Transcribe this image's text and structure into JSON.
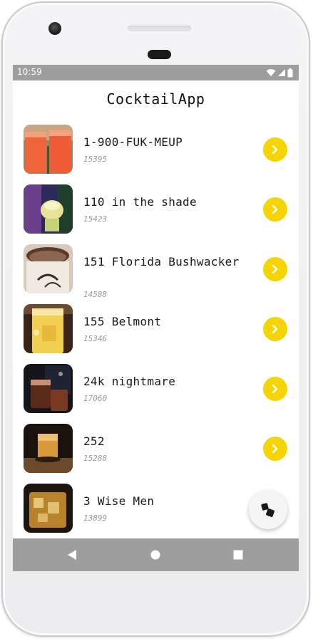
{
  "status_bar": {
    "time": "10:59",
    "icons": [
      "wifi-icon",
      "signal-icon",
      "battery-icon"
    ]
  },
  "app": {
    "title": "CocktailApp"
  },
  "drinks": [
    {
      "name": "1-900-FUK-MEUP",
      "id": "15395"
    },
    {
      "name": "110 in the shade",
      "id": "15423"
    },
    {
      "name": "151 Florida Bushwacker",
      "id": "14588"
    },
    {
      "name": "155 Belmont",
      "id": "15346"
    },
    {
      "name": "24k nightmare",
      "id": "17060"
    },
    {
      "name": "252",
      "id": "15288"
    },
    {
      "name": "3 Wise Men",
      "id": "13899"
    }
  ],
  "icons": {
    "row_action": "chevron-right-icon",
    "fab": "dice-icon",
    "nav": [
      "back-icon",
      "home-icon",
      "recents-icon"
    ]
  },
  "colors": {
    "accent": "#f5d400",
    "system_bars": "#9e9e9e",
    "title_text": "#111111",
    "secondary_text": "#9a9a9a"
  }
}
